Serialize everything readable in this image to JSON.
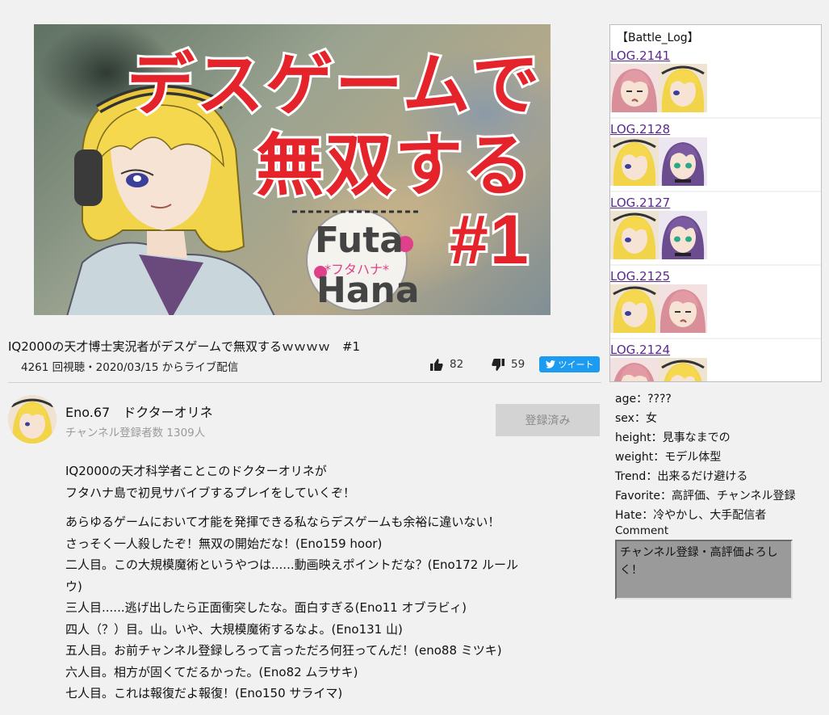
{
  "thumbnail": {
    "title_line1": "デスゲームで",
    "title_line2": "無双する",
    "episode": "#1",
    "logo_top": "Futa",
    "logo_mid": "*フタハナ*",
    "logo_bottom": "Hana"
  },
  "video": {
    "title": "IQ2000の天才博士実況者がデスゲームで無双するｗｗｗｗ　#1",
    "meta": "4261 回視聴・2020/03/15 からライブ配信",
    "likes": "82",
    "dislikes": "59",
    "tweet_label": "ツイート"
  },
  "channel": {
    "name": "Eno.67　ドクターオリネ",
    "subscribers": "チャンネル登録者数 1309人",
    "subscribe_button": "登録済み"
  },
  "description": {
    "para1": [
      "IQ2000の天才科学者ことこのドクターオリネが",
      "フタハナ島で初見サバイブするプレイをしていくぞ！"
    ],
    "para2": [
      "あらゆるゲームにおいて才能を発揮できる私ならデスゲームも余裕に違いない！",
      "さっそく一人殺したぞ！無双の開始だな！(Eno159 hoor)",
      "二人目。この大規模魔術というやつは......動画映えポイントだな？(Eno172 ルール",
      "ウ)",
      "三人目......逃げ出したら正面衝突したな。面白すぎる(Eno11 オブラビィ)",
      "四人（？）目。山。いや、大規模魔術するなよ。(Eno131 山)",
      "五人目。お前チャンネル登録しろって言っただろ何狂ってんだ！(eno88 ミツキ)",
      "六人目。相方が固くてだるかった。(Eno82 ムラサキ)",
      "七人目。これは報復だよ報復！(Eno150 サライマ)"
    ]
  },
  "battle_log": {
    "heading": "【Battle_Log】",
    "entries": [
      {
        "label": "LOG.2141",
        "pics": [
          "pink-hair-avatar",
          "blonde-avatar"
        ]
      },
      {
        "label": "LOG.2128",
        "pics": [
          "blonde-avatar",
          "purple-hair-avatar"
        ]
      },
      {
        "label": "LOG.2127",
        "pics": [
          "blonde-avatar",
          "purple-hair-avatar"
        ]
      },
      {
        "label": "LOG.2125",
        "pics": [
          "blonde-avatar",
          "pink-hair-avatar"
        ]
      },
      {
        "label": "LOG.2124",
        "pics": [
          "pink-hair-avatar",
          "blonde-avatar"
        ]
      }
    ]
  },
  "profile": {
    "age": "age：????",
    "sex": "sex：女",
    "height": "height：見事なまでの",
    "weight": "weight：モデル体型",
    "trend": "Trend：出来るだけ避ける",
    "favorite": "Favorite：高評価、チャンネル登録",
    "hate": "Hate：冷やかし、大手配信者",
    "comment_label": "Comment",
    "comment": "チャンネル登録・高評価よろしく！"
  },
  "colors": {
    "title_red": "#e5232b",
    "tweet_blue": "#1d9bf0",
    "log_link": "#5a2b8f",
    "page_bg": "#f1f1f1"
  }
}
